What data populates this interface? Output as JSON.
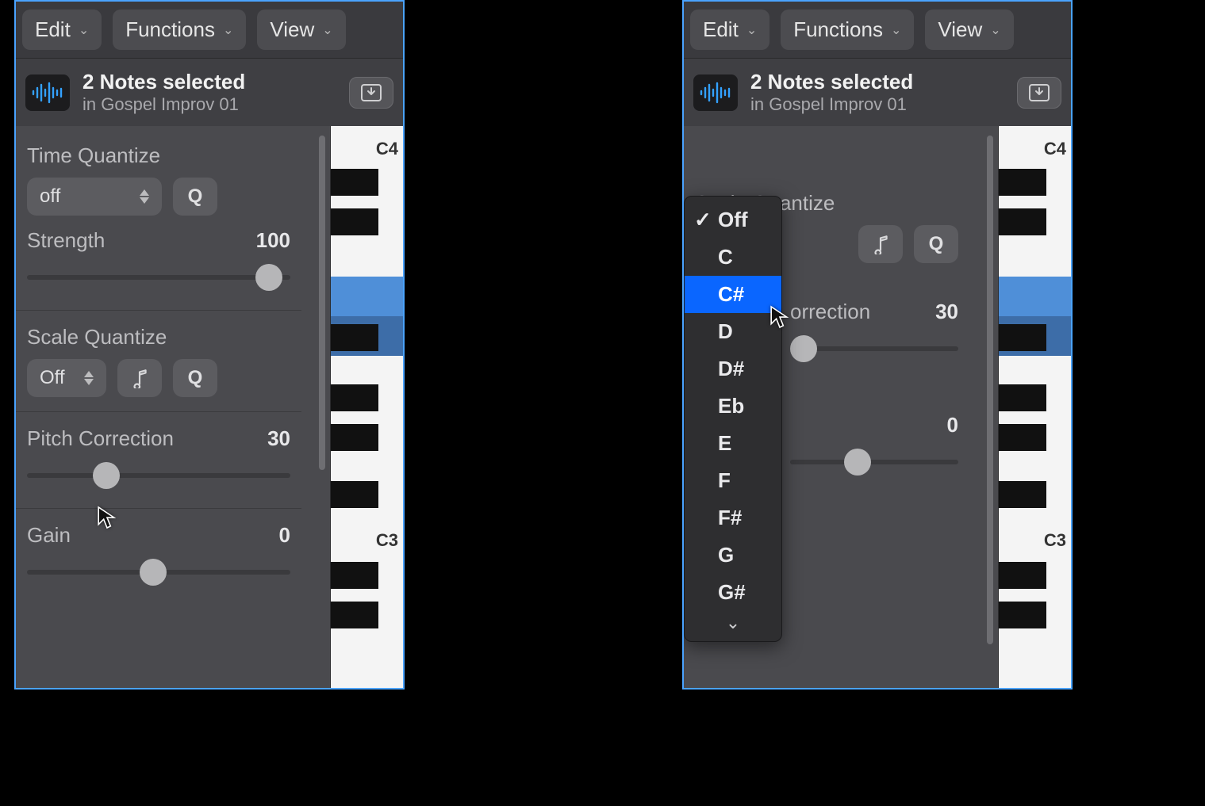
{
  "menubar": {
    "edit": "Edit",
    "functions": "Functions",
    "view": "View"
  },
  "header": {
    "title": "2 Notes selected",
    "subtitle": "in Gospel Improv 01"
  },
  "left": {
    "timeQuantize": {
      "label": "Time Quantize",
      "value": "off",
      "q": "Q"
    },
    "strength": {
      "label": "Strength",
      "value": "100",
      "pct": 100
    },
    "scaleQuantize": {
      "label": "Scale Quantize",
      "value": "Off",
      "q": "Q"
    },
    "pitchCorrection": {
      "label": "Pitch Correction",
      "value": "30",
      "pct": 30
    },
    "gain": {
      "label": "Gain",
      "value": "0",
      "pct": 50
    },
    "piano": {
      "topLabel": "C4",
      "bottomLabel": "C3"
    }
  },
  "right": {
    "scaleQuantize": {
      "label": "Scale Quantize",
      "q": "Q"
    },
    "pitchCorrection": {
      "labelFragment": "orrection",
      "value": "30",
      "pct": 30
    },
    "secondValue": {
      "value": "0",
      "pct": 50
    },
    "piano": {
      "topLabel": "C4",
      "bottomLabel": "C3"
    },
    "dropdown": {
      "checkedIndex": 0,
      "selectedIndex": 2,
      "items": [
        "Off",
        "C",
        "C#",
        "D",
        "D#",
        "Eb",
        "E",
        "F",
        "F#",
        "G",
        "G#"
      ]
    }
  }
}
